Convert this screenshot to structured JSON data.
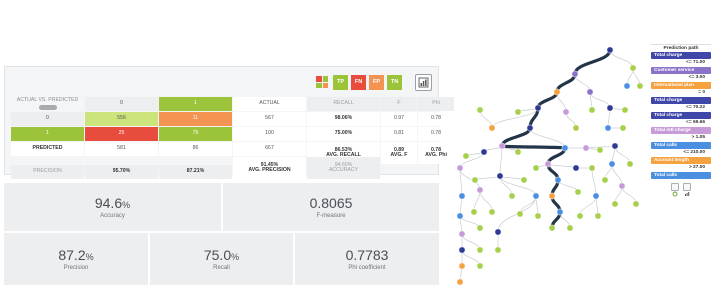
{
  "confusion_matrix": {
    "header_label": "ACTUAL VS. PREDICTED",
    "toggle_label": "SHOW",
    "legend": [
      "TP",
      "FN",
      "FP",
      "TN"
    ],
    "colors": {
      "TP": "#9cc43a",
      "FN": "#e84c3d",
      "FP": "#f39452",
      "TN": "#9cc43a",
      "TP_light": "#cde47d"
    },
    "col_headers": {
      "class0": "0",
      "class1": "1",
      "actual": "ACTUAL",
      "recall": "RECALL",
      "f": "F",
      "phi": "Phi"
    },
    "rows": [
      {
        "label": "0",
        "v0": "556",
        "v1": "11",
        "actual": "567",
        "recall": "98.06%",
        "f": "0.97",
        "phi": "0.78"
      },
      {
        "label": "1",
        "v0": "25",
        "v1": "75",
        "actual": "100",
        "recall": "75.00%",
        "f": "0.81",
        "phi": "0.78"
      }
    ],
    "predicted_row": {
      "label": "PREDICTED",
      "v0": "581",
      "v1": "86",
      "actual": "667",
      "avg_recall_value": "86.53%",
      "avg_recall_label": "AVG. RECALL",
      "avg_f_value": "0.89",
      "avg_f_label": "AVG. F",
      "avg_phi_value": "0.78",
      "avg_phi_label": "AVG. Phi"
    },
    "precision_row": {
      "label": "PRECISION",
      "p0": "95.70%",
      "p1": "87.21%",
      "avg_precision_value": "91.45%",
      "avg_precision_label": "AVG. PRECISION",
      "accuracy_value": "94.60%",
      "accuracy_label": "ACCURACY"
    }
  },
  "metrics": {
    "accuracy": {
      "value": "94.6",
      "unit": "%",
      "label": "Accuracy"
    },
    "f_measure": {
      "value": "0.8065",
      "unit": "",
      "label": "F-measure"
    },
    "precision": {
      "value": "87.2",
      "unit": "%",
      "label": "Precision"
    },
    "recall": {
      "value": "75.0",
      "unit": "%",
      "label": "Recall"
    },
    "phi": {
      "value": "0.7783",
      "unit": "",
      "label": "Phi coefficient"
    }
  },
  "prediction_path": {
    "title": "Prediction path",
    "steps": [
      {
        "kind": "node",
        "text": "Total charge",
        "color": "#3f47a8"
      },
      {
        "kind": "cond",
        "text": "<= 71.00"
      },
      {
        "kind": "node",
        "text": "Customer service",
        "color": "#8a72c9"
      },
      {
        "kind": "cond",
        "text": "<= 3.00"
      },
      {
        "kind": "node",
        "text": "International plan",
        "color": "#f4a240"
      },
      {
        "kind": "cond",
        "text": "= 0"
      },
      {
        "kind": "node",
        "text": "Total charge",
        "color": "#3f47a8"
      },
      {
        "kind": "cond",
        "text": "<= 70.22"
      },
      {
        "kind": "node",
        "text": "Total charge",
        "color": "#3f47a8"
      },
      {
        "kind": "cond",
        "text": "<= 69.66"
      },
      {
        "kind": "node",
        "text": "Total intl charge",
        "color": "#c79ad8"
      },
      {
        "kind": "cond",
        "text": "> 1.05"
      },
      {
        "kind": "node",
        "text": "Total calls",
        "color": "#4a8fe0"
      },
      {
        "kind": "cond",
        "text": "<= 210.00"
      },
      {
        "kind": "node",
        "text": "Account length",
        "color": "#f4a240"
      },
      {
        "kind": "cond",
        "text": "> 27.00"
      },
      {
        "kind": "node",
        "text": "Total calls",
        "color": "#4a8fe0"
      }
    ]
  },
  "tree": {
    "node_colors": {
      "charge": "#2f3a94",
      "service": "#8a72c9",
      "intl": "#f4a240",
      "intl_charge": "#c79ad8",
      "calls": "#4a8fe0",
      "leaf": "#a6cf4c",
      "path": "#233548"
    }
  }
}
